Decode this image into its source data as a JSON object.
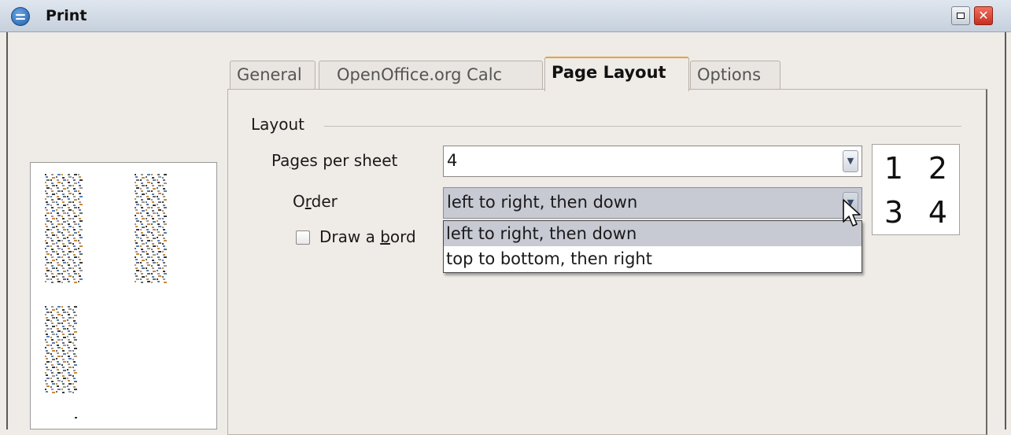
{
  "window": {
    "title": "Print"
  },
  "tabs": [
    {
      "label": "General",
      "active": false
    },
    {
      "label": "OpenOffice.org Calc",
      "active": false
    },
    {
      "label": "Page Layout",
      "active": true
    },
    {
      "label": "Options",
      "active": false
    }
  ],
  "layout": {
    "section_label": "Layout",
    "pages_per_sheet": {
      "label_pre": "Pa",
      "label_key": "g",
      "label_post": "es per sheet",
      "value": "4"
    },
    "order": {
      "label_pre": "O",
      "label_key": "r",
      "label_post": "der",
      "value": "left to right, then down",
      "options": [
        "left to right, then down",
        "top to bottom, then right"
      ],
      "highlighted_option": "left to right, then down"
    },
    "draw_border": {
      "label_pre": "Draw a ",
      "label_key": "b",
      "label_post": "ord",
      "checked": false
    },
    "order_preview": [
      "1",
      "2",
      "3",
      "4"
    ]
  },
  "icons": {
    "app": "openoffice-icon",
    "minimize": "minimize-icon",
    "close": "close-icon",
    "dropdown": "chevron-down-icon",
    "cursor": "mouse-pointer-icon"
  },
  "colors": {
    "titlebar": "#c6d0dc",
    "active_tab_accent": "#e9a23b",
    "close_button": "#c5301f",
    "selection": "#c7c9d3"
  }
}
